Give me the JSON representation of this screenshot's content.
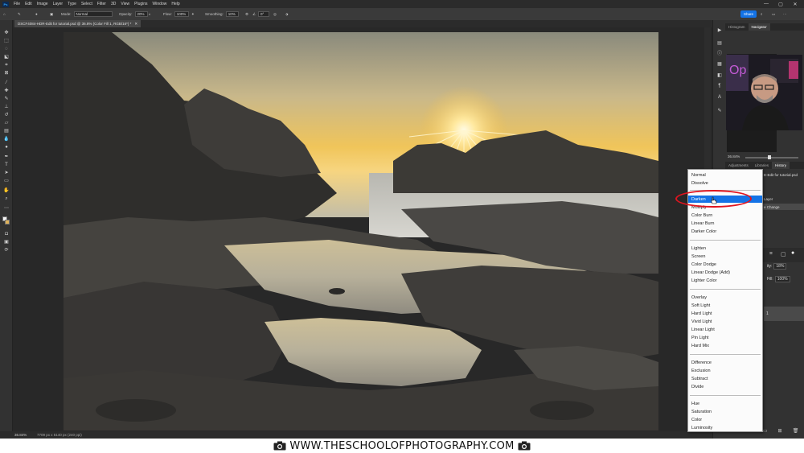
{
  "app": {
    "logo": "Ps",
    "menus": [
      "File",
      "Edit",
      "Image",
      "Layer",
      "Type",
      "Select",
      "Filter",
      "3D",
      "View",
      "Plugins",
      "Window",
      "Help"
    ],
    "window_controls": [
      "—",
      "▢",
      "✕"
    ]
  },
  "options": {
    "mode_label": "Mode:",
    "mode_value": "Normal",
    "opacity_label": "Opacity:",
    "opacity_value": "20%",
    "flow_label": "Flow:",
    "flow_value": "100%",
    "smoothing_label": "Smoothing:",
    "smoothing_value": "10%",
    "angle_value": "0°",
    "share_label": "Share"
  },
  "document": {
    "tab_title": "DSCF4084-HDR-Edit for tutorial.psd @ 36.8% (Color Fill 1, RGB/16*) *",
    "zoom": "36.84%",
    "doc_info": "7709 px x 5140 px (240 ppi)"
  },
  "panels": {
    "top_tabs": [
      "Histogram",
      "Navigator"
    ],
    "navigator_zoom": "36.84%",
    "mid_tabs": [
      "Adjustments",
      "Libraries",
      "History"
    ],
    "history_items": [
      "E-Edit for tutorial.psd",
      "Layer",
      "e Change"
    ],
    "layers_opacity_label": "ity:",
    "layers_opacity_value": "18%",
    "layers_fill_label": "Fill:",
    "layers_fill_value": "100%",
    "layer_name": "1"
  },
  "blend_menu": {
    "selected": "Darken",
    "groups": [
      [
        "Normal",
        "Dissolve"
      ],
      [
        "Darken",
        "Multiply",
        "Color Burn",
        "Linear Burn",
        "Darker Color"
      ],
      [
        "Lighten",
        "Screen",
        "Color Dodge",
        "Linear Dodge (Add)",
        "Lighter Color"
      ],
      [
        "Overlay",
        "Soft Light",
        "Hard Light",
        "Vivid Light",
        "Linear Light",
        "Pin Light",
        "Hard Mix"
      ],
      [
        "Difference",
        "Exclusion",
        "Subtract",
        "Divide"
      ],
      [
        "Hue",
        "Saturation",
        "Color",
        "Luminosity"
      ]
    ]
  },
  "footer": {
    "url": "WWW.THESCHOOLOFPHOTOGRAPHY.COM"
  },
  "colors": {
    "accent": "#1473e6",
    "highlight_ring": "#e0141f",
    "ui_dark": "#323232"
  }
}
